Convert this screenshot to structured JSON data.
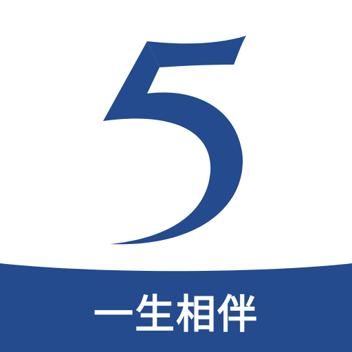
{
  "brand": {
    "numeral": "5",
    "tagline": "一生相伴"
  },
  "colors": {
    "background": "#ffffff",
    "brand_blue": "#234b8d",
    "text_on_band": "#ffffff"
  },
  "icons": {
    "logo": "numeral-five-logo-icon"
  }
}
